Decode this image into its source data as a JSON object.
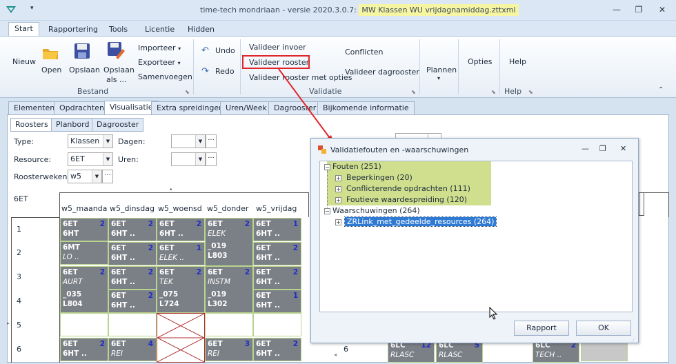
{
  "window": {
    "title_prefix": "time-tech mondriaan - versie 2020.3.0.7:",
    "title_file": "MW Klassen WU vrijdagnamiddag.zttxml",
    "minimize": "—",
    "restore": "❐",
    "close": "✕"
  },
  "ribbon_tabs": [
    "Start",
    "Rapportering",
    "Tools",
    "Licentie",
    "Hidden"
  ],
  "ribbon": {
    "nieuw": "Nieuw",
    "open": "Open",
    "opslaan": "Opslaan",
    "opslaan_als_1": "Opslaan",
    "opslaan_als_2": "als ...",
    "importeer": "Importeer",
    "exporteer": "Exporteer",
    "samenvoegen": "Samenvoegen",
    "bestand": "Bestand",
    "undo": "Undo",
    "redo": "Redo",
    "valideer_invoer": "Valideer invoer",
    "valideer_rooster": "Valideer rooster",
    "valideer_rooster_opties": "Valideer rooster met opties",
    "conflicten": "Conflicten",
    "valideer_dagrooster": "Valideer dagrooster",
    "validatie": "Validatie",
    "plannen": "Plannen",
    "opties": "Opties",
    "help": "Help",
    "help_group": "Help"
  },
  "main_tabs": [
    "Elementen",
    "Opdrachten",
    "Visualisatie",
    "Extra spreidingen",
    "Uren/Week",
    "Dagrooster",
    "Bijkomende informatie"
  ],
  "sub_tabs": [
    "Roosters",
    "Planbord",
    "Dagrooster"
  ],
  "filters": {
    "type_label": "Type:",
    "type_value": "Klassen",
    "dagen_label": "Dagen:",
    "resource_label": "Resource:",
    "resource_value": "6ET",
    "uren_label": "Uren:",
    "roosterweken_label": "Roosterweken:",
    "roosterweken_value": "w5"
  },
  "grid": {
    "class_label": "6ET",
    "columns": [
      "w5_maanda",
      "w5_dinsdag",
      "w5_woensd",
      "w5_donder",
      "w5_vrijdag"
    ],
    "rows": [
      "1",
      "2",
      "3",
      "4",
      "5",
      "6"
    ],
    "cells": {
      "r1c1": {
        "l1": "6ET",
        "l2": "6HT",
        "n": "2"
      },
      "r1c2": {
        "l1": "6ET",
        "l2": "6HT ..",
        "n": "2"
      },
      "r1c3": {
        "l1": "6ET",
        "l2": "6HT ..",
        "n": "2"
      },
      "r1c4": {
        "l1": "6ET",
        "l2": "ELEK",
        "n": "2"
      },
      "r1c5": {
        "l1": "6ET",
        "l2": "6HT ..",
        "n": "1"
      },
      "r2c1": {
        "l1": "6MT",
        "l2": "LO .."
      },
      "r2c2": {
        "l1": "6ET",
        "l2": "6HT ..",
        "n": "2"
      },
      "r2c3": {
        "l1": "6ET",
        "l2": "ELEK ..",
        "n": "1"
      },
      "r2c4": {
        "l1": "_019",
        "l2": "L803"
      },
      "r2c5": {
        "l1": "6ET",
        "l2": "6HT ..",
        "n": "2"
      },
      "r3c1": {
        "l1": "6ET",
        "l2": "AURT",
        "n": "2"
      },
      "r3c2": {
        "l1": "6ET",
        "l2": "6HT ..",
        "n": "2"
      },
      "r3c3": {
        "l1": "6ET",
        "l2": "TEK",
        "n": "2"
      },
      "r3c4": {
        "l1": "6ET",
        "l2": "INSTM",
        "n": "2"
      },
      "r3c5": {
        "l1": "6ET",
        "l2": "6HT ..",
        "n": "2"
      },
      "r4c1": {
        "l1": "_035",
        "l2": "L804"
      },
      "r4c2": {
        "l1": "6ET",
        "l2": "6HT ..",
        "n": "2"
      },
      "r4c3": {
        "l1": "_075",
        "l2": "L724"
      },
      "r4c4": {
        "l1": "_019",
        "l2": "L302"
      },
      "r4c5": {
        "l1": "6ET",
        "l2": "6HT ..",
        "n": "1"
      },
      "r6c1": {
        "l1": "6ET",
        "l2": "6HT ..",
        "n": "2"
      },
      "r6c2": {
        "l1": "6ET",
        "l2": "REI",
        "n": "4"
      },
      "r6c4": {
        "l1": "6ET",
        "l2": "REI",
        "n": "3"
      },
      "r6c5": {
        "l1": "6ET",
        "l2": "6HT ..",
        "n": "2"
      }
    }
  },
  "right_panel": {
    "row_label": "6",
    "cells": [
      {
        "l1": "6LC",
        "l2": "RLASC",
        "n": "12"
      },
      {
        "l1": "6LC",
        "l2": "RLASC",
        "n": "5"
      },
      {
        "l1": "6LC",
        "l2": "TECH ..",
        "n": "2"
      }
    ]
  },
  "dialog": {
    "title": "Validatiefouten en -waarschuwingen",
    "fouten": "Fouten (251)",
    "beperkingen": "Beperkingen (20)",
    "conflicterende": "Conflicterende opdrachten (111)",
    "foutieve": "Foutieve waardespreiding (120)",
    "waarschuwingen": "Waarschuwingen (264)",
    "zrlink": "ZRLink_met_gedeelde_resources (264)",
    "rapport": "Rapport",
    "ok": "OK"
  },
  "colors": {
    "highlight": "#cfdf8e",
    "annotation_red": "#e0262a",
    "cell_gray": "#7b7f86",
    "selection_blue": "#2f7bd4"
  }
}
